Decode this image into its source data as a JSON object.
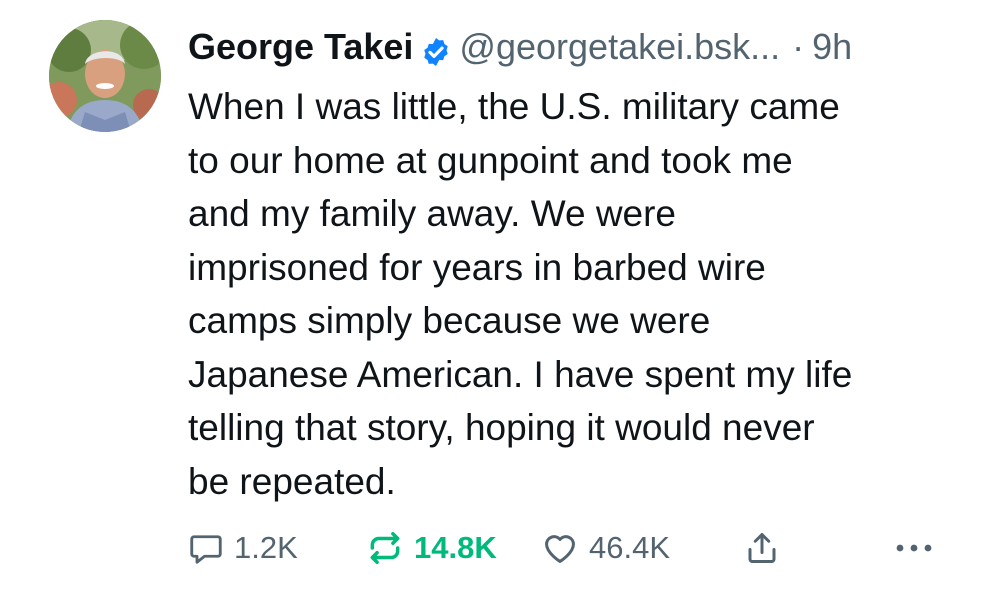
{
  "post": {
    "author_name": "George Takei",
    "handle": "@georgetakei.bsk...",
    "separator": "·",
    "time": "9h",
    "text": "When I was little, the U.S. military came\nto our home at gunpoint and took me\nand my family away. We were\nimprisoned for years in barbed wire\ncamps simply because we were\nJapanese American. I have spent my life\ntelling that story, hoping it would never\nbe repeated."
  },
  "actions": {
    "replies": "1.2K",
    "reposts": "14.8K",
    "likes": "46.4K"
  },
  "icons": {
    "verified": "verified-badge-icon",
    "reply": "comment-icon",
    "repost": "repost-icon",
    "like": "heart-icon",
    "share": "share-icon",
    "more": "more-dots-icon"
  },
  "colors": {
    "verified_blue": "#1083fe",
    "repost_active": "#00ba7c",
    "secondary_text": "#536471",
    "primary_text": "#0f1419"
  }
}
